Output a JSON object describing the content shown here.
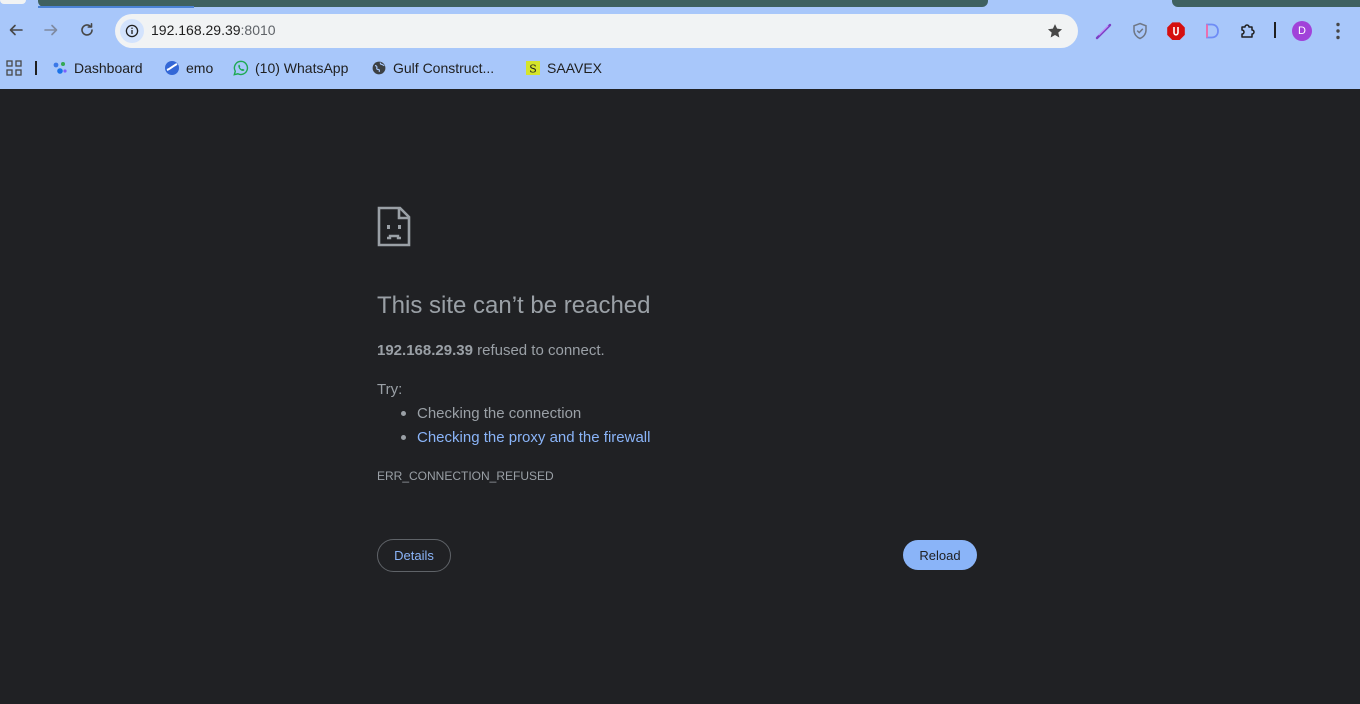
{
  "browser": {
    "address": {
      "host": "192.168.29.39",
      "port": ":8010"
    },
    "icons": {
      "site_info": "info-icon",
      "bookmark": "star-icon",
      "extensions": [
        "feather-extension-icon",
        "shield-extension-icon",
        "ublock-extension-icon",
        "d-extension-icon",
        "puzzle-extensions-icon"
      ],
      "menu": "kebab-menu-icon"
    },
    "profile_initial": "D",
    "colors": {
      "chrome": "#a8c7fa",
      "avatar": "#a142d9",
      "page_bg": "#202124",
      "link": "#8ab4f8"
    }
  },
  "bookmarks": [
    {
      "label": "Dashboard",
      "icon": "dashboard-favicon"
    },
    {
      "label": "emo",
      "icon": "emo-favicon"
    },
    {
      "label": "(10) WhatsApp",
      "icon": "whatsapp-favicon"
    },
    {
      "label": "Gulf Construct...",
      "icon": "globe-favicon"
    },
    {
      "label": "SAAVEX",
      "icon": "saavex-favicon"
    }
  ],
  "error_page": {
    "icon": "sad-page-icon",
    "title": "This site can’t be reached",
    "host": "192.168.29.39",
    "message": " refused to connect.",
    "try_label": "Try:",
    "suggestions": [
      {
        "text": "Checking the connection",
        "link": false
      },
      {
        "text": "Checking the proxy and the firewall",
        "link": true
      }
    ],
    "error_code": "ERR_CONNECTION_REFUSED",
    "details_label": "Details",
    "reload_label": "Reload"
  }
}
